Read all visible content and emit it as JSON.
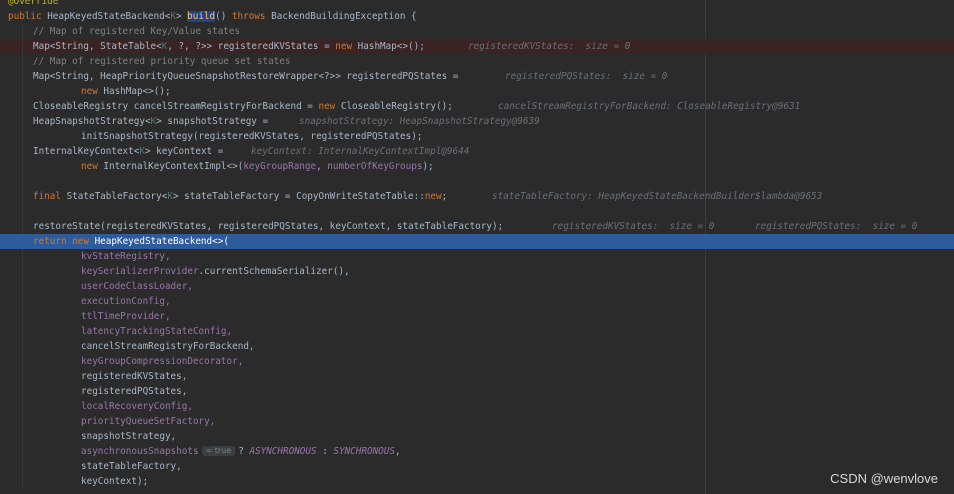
{
  "watermark": "CSDN @wenvlove",
  "lines": {
    "l0": "@Override",
    "l1": {
      "kw1": "public ",
      "a": "HeapKeyedStateBackend<",
      "tp": "K",
      "b": "> ",
      "m": "build",
      "c": "() ",
      "kw2": "throws ",
      "d": "BackendBuildingException {"
    },
    "l2": "// Map of registered Key/Value states",
    "l3": {
      "a": "Map<String, StateTable<",
      "tp": "K",
      "b": ", ?, ?>> registeredKVStates = ",
      "kw": "new ",
      "c": "HashMap<>();",
      "inl": "registeredKVStates:  size = 0"
    },
    "l4": "// Map of registered priority queue set states",
    "l5": {
      "a": "Map<String, HeapPriorityQueueSnapshotRestoreWrapper<?>> registeredPQStates = ",
      "inl": "registeredPQStates:  size = 0"
    },
    "l6": {
      "kw": "new ",
      "a": "HashMap<>();"
    },
    "l7": {
      "a": "CloseableRegistry cancelStreamRegistryForBackend = ",
      "kw": "new ",
      "b": "CloseableRegistry();",
      "inl": "cancelStreamRegistryForBackend: CloseableRegistry@9631"
    },
    "l8": {
      "a": "HeapSnapshotStrategy<",
      "tp": "K",
      "b": "> snapshotStrategy = ",
      "inl": "snapshotStrategy: HeapSnapshotStrategy@9639"
    },
    "l9": "initSnapshotStrategy(registeredKVStates, registeredPQStates);",
    "l10": {
      "a": "InternalKeyContext<",
      "tp": "K",
      "b": "> keyContext = ",
      "inl": "keyContext: InternalKeyContextImpl@9644"
    },
    "l11": {
      "kw": "new ",
      "a": "InternalKeyContextImpl<>(",
      "f1": "keyGroupRange",
      "b": ", ",
      "f2": "numberOfKeyGroups",
      "c": ");"
    },
    "l12": {
      "kw": "final ",
      "a": "StateTableFactory<",
      "tp": "K",
      "b": "> stateTableFactory = CopyOnWriteStateTable::",
      "kw2": "new",
      "c": ";",
      "inl": "stateTableFactory: HeapKeyedStateBackendBuilder$lambda@9653"
    },
    "l13": {
      "a": "restoreState(registeredKVStates, registeredPQStates, keyContext, stateTableFactory);",
      "inl1": "registeredKVStates:  size = 0",
      "inl2": "registeredPQStates:  size = 0"
    },
    "l14": {
      "kw1": "return ",
      "kw2": "new ",
      "a": "HeapKeyedStateBackend<>("
    },
    "args": [
      "kvStateRegistry,",
      "keySerializerProvider.currentSchemaSerializer(),",
      "userCodeClassLoader,",
      "executionConfig,",
      "ttlTimeProvider,",
      "latencyTrackingStateConfig,",
      "cancelStreamRegistryForBackend,",
      "keyGroupCompressionDecorator,",
      "registeredKVStates,",
      "registeredPQStates,",
      "localRecoveryConfig,",
      "priorityQueueSetFactory,",
      "snapshotStrategy,"
    ],
    "l28": {
      "f": "asynchronousSnapshots",
      "hint": "= true",
      "a": "? ",
      "e1": "ASYNCHRONOUS",
      "b": " : ",
      "e2": "SYNCHRONOUS",
      "c": ","
    },
    "l29": "stateTableFactory,",
    "l30": "keyContext);"
  }
}
